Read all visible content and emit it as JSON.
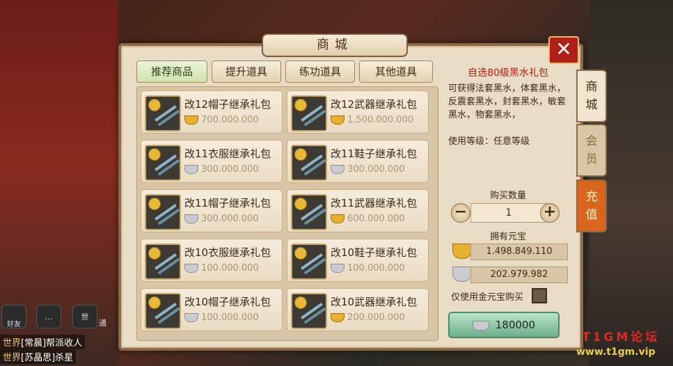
{
  "window": {
    "title": "商城",
    "close_label": "✕"
  },
  "tabs": [
    {
      "label": "推荐商品",
      "active": true
    },
    {
      "label": "提升道具",
      "active": false
    },
    {
      "label": "练功道具",
      "active": false
    },
    {
      "label": "其他道具",
      "active": false
    }
  ],
  "items": [
    {
      "name": "改12帽子继承礼包",
      "price": "700.000.000",
      "currency": "gold"
    },
    {
      "name": "改12武器继承礼包",
      "price": "1.500.000.000",
      "currency": "gold"
    },
    {
      "name": "改11衣服继承礼包",
      "price": "300.000.000",
      "currency": "silver"
    },
    {
      "name": "改11鞋子继承礼包",
      "price": "300.000.000",
      "currency": "silver"
    },
    {
      "name": "改11帽子继承礼包",
      "price": "300.000.000",
      "currency": "silver"
    },
    {
      "name": "改11武器继承礼包",
      "price": "600.000.000",
      "currency": "gold"
    },
    {
      "name": "改10衣服继承礼包",
      "price": "100.000.000",
      "currency": "silver"
    },
    {
      "name": "改10鞋子继承礼包",
      "price": "100.000.000",
      "currency": "silver"
    },
    {
      "name": "改10帽子继承礼包",
      "price": "100.000.000",
      "currency": "silver"
    },
    {
      "name": "改10武器继承礼包",
      "price": "200.000.000",
      "currency": "gold"
    }
  ],
  "detail": {
    "title": "自选80级黑水礼包",
    "description": "可获得法套黑水，体套黑水，反震套黑水，封套黑水，敏套黑水，物套黑水，",
    "level": "使用等级：任意等级",
    "qty_label": "购买数量",
    "minus": "−",
    "plus": "+",
    "qty": "1",
    "owned_label": "拥有元宝",
    "gold_balance": "1.498.849.110",
    "silver_balance": "202.979.982",
    "gold_only_label": "仅使用金元宝购买",
    "buy_price": "180000"
  },
  "side_tabs": [
    {
      "label": "商\n城"
    },
    {
      "label": "会\n员"
    },
    {
      "label": "充\n值"
    }
  ],
  "chat": {
    "friend_label": "好友",
    "voice_label": "世",
    "channel_label": "通",
    "lines": [
      {
        "channel": "世界",
        "text": "[常晨]帮派收人"
      },
      {
        "channel": "世界",
        "text": "[苏晶思]杀星"
      }
    ]
  },
  "watermark": {
    "brand": "T1GM论坛",
    "url": "www.t1gm.vip"
  },
  "colors": {
    "gold": "#e8b030",
    "silver": "#c8ccd0",
    "title_red": "#c01818",
    "buy_green": "#6cae8a"
  }
}
